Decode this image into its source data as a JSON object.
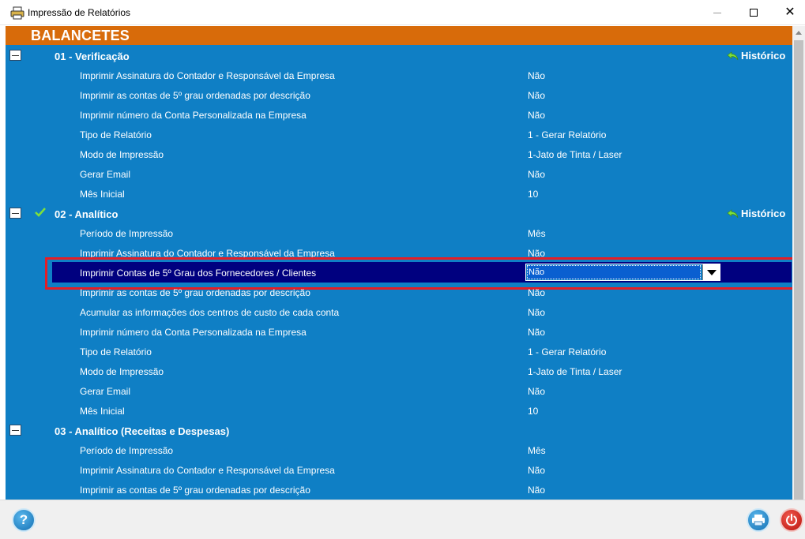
{
  "window": {
    "title": "Impressão de Relatórios",
    "close_glyph": "✕"
  },
  "header": {
    "title": "BALANCETES"
  },
  "history_label": "Histórico",
  "sections": [
    {
      "title": "01 - Verificação",
      "items": [
        {
          "label": "Imprimir Assinatura do Contador e Responsável da Empresa",
          "value": "Não"
        },
        {
          "label": "Imprimir as contas de 5º grau ordenadas por descrição",
          "value": "Não"
        },
        {
          "label": "Imprimir número da Conta Personalizada na Empresa",
          "value": "Não"
        },
        {
          "label": "Tipo de Relatório",
          "value": "1 - Gerar Relatório"
        },
        {
          "label": "Modo de Impressão",
          "value": "1-Jato de Tinta / Laser"
        },
        {
          "label": "Gerar Email",
          "value": "Não"
        },
        {
          "label": "Mês Inicial",
          "value": "10"
        }
      ]
    },
    {
      "title": "02 - Analítico",
      "items": [
        {
          "label": "Período de Impressão",
          "value": "Mês"
        },
        {
          "label": "Imprimir Assinatura do Contador e Responsável da Empresa",
          "value": "Não"
        },
        {
          "label": "Imprimir Contas de 5º Grau dos Fornecedores / Clientes",
          "value": "Não"
        },
        {
          "label": "Imprimir as contas de 5º grau ordenadas por descrição",
          "value": "Não"
        },
        {
          "label": "Acumular as informações dos centros de custo de cada conta",
          "value": "Não"
        },
        {
          "label": "Imprimir número da Conta Personalizada na Empresa",
          "value": "Não"
        },
        {
          "label": "Tipo de Relatório",
          "value": "1 - Gerar Relatório"
        },
        {
          "label": "Modo de Impressão",
          "value": "1-Jato de Tinta / Laser"
        },
        {
          "label": "Gerar Email",
          "value": "Não"
        },
        {
          "label": "Mês Inicial",
          "value": "10"
        }
      ]
    },
    {
      "title": "03 - Analítico (Receitas e Despesas)",
      "items": [
        {
          "label": "Período de Impressão",
          "value": "Mês"
        },
        {
          "label": "Imprimir Assinatura do Contador e Responsável da Empresa",
          "value": "Não"
        },
        {
          "label": "Imprimir as contas de 5º grau ordenadas por descrição",
          "value": "Não"
        }
      ]
    }
  ],
  "bottom": {
    "help_label": "?"
  },
  "colors": {
    "panel": "#0f7fc5",
    "header": "#d86b0a",
    "selected_row": "#00007f",
    "highlight": "#e41e26"
  }
}
